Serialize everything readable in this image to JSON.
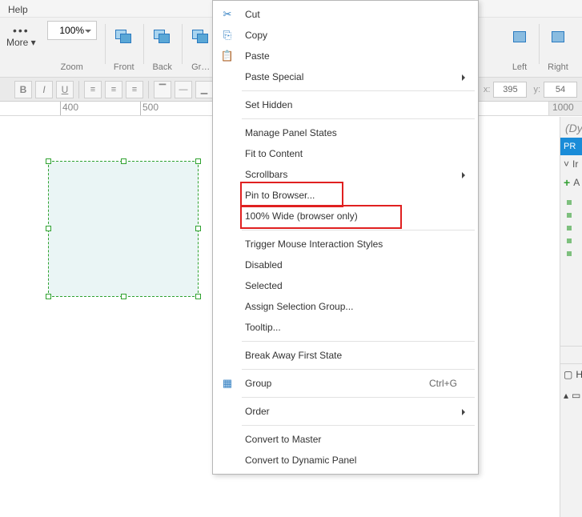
{
  "menu": {
    "help": "Help"
  },
  "ribbon": {
    "more": "More ▾",
    "zoom_value": "100%",
    "zoom_label": "Zoom",
    "front_label": "Front",
    "back_label": "Back",
    "group_label": "Gr…",
    "left_label": "Left",
    "right_label": "Right"
  },
  "stylebar": {
    "x_label": "x:",
    "x_value": "395",
    "y_label": "y:",
    "y_value": "54"
  },
  "ruler": {
    "t400": "400",
    "t500": "500",
    "rcap": "1000"
  },
  "context_menu": {
    "cut": {
      "label": "Cut"
    },
    "copy": {
      "label": "Copy"
    },
    "paste": {
      "label": "Paste"
    },
    "paste_special": {
      "label": "Paste Special"
    },
    "set_hidden": {
      "label": "Set Hidden"
    },
    "manage_panel_states": {
      "label": "Manage Panel States"
    },
    "fit_to_content": {
      "label": "Fit to Content"
    },
    "scrollbars": {
      "label": "Scrollbars"
    },
    "pin_to_browser": {
      "label": "Pin to Browser..."
    },
    "hundred_wide": {
      "label": "100% Wide (browser only)"
    },
    "trigger_mis": {
      "label": "Trigger Mouse Interaction Styles"
    },
    "disabled": {
      "label": "Disabled"
    },
    "selected": {
      "label": "Selected"
    },
    "assign_sel_group": {
      "label": "Assign Selection Group..."
    },
    "tooltip": {
      "label": "Tooltip..."
    },
    "break_away": {
      "label": "Break Away First State"
    },
    "group": {
      "label": "Group",
      "shortcut": "Ctrl+G"
    },
    "order": {
      "label": "Order"
    },
    "convert_master": {
      "label": "Convert to Master"
    },
    "convert_dynamic": {
      "label": "Convert to Dynamic Panel"
    }
  },
  "right_panel": {
    "title": "(Dy",
    "properties_btn": "PR",
    "tree_toggle": "˅",
    "interactions_label": "Ir",
    "add_label": "A",
    "lower_h": "H"
  }
}
